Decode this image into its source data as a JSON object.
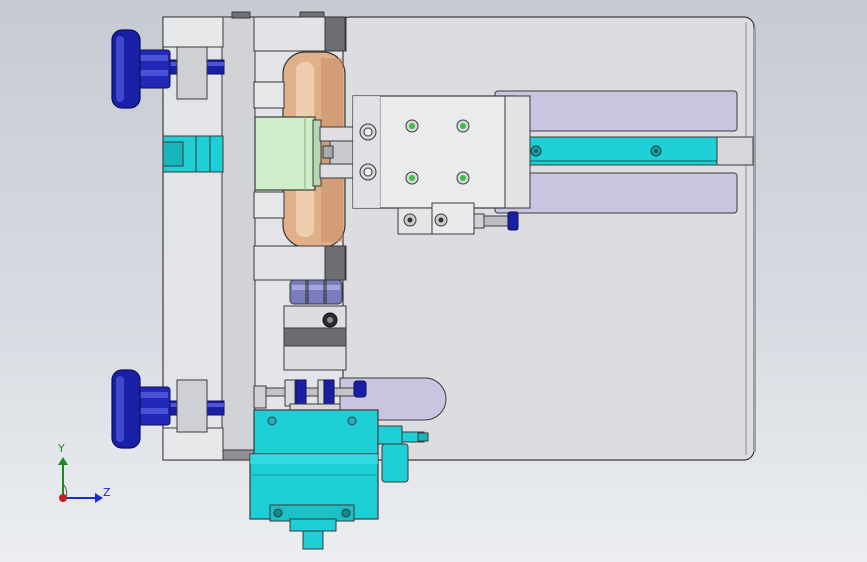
{
  "viewport": {
    "background_top": "#c6cbd3",
    "background_bottom": "#eceef1"
  },
  "colors": {
    "plate": "#dcdde0",
    "plate_shadow": "#b3b5ba",
    "edge": "#3a3a3a",
    "knob_blue": "#1a1fa8",
    "cyan": "#1fcfd6",
    "copper": "#e0b089",
    "green_block": "#cdeec9",
    "lavender": "#c9c5e0",
    "screw_green": "#39c43b"
  },
  "triad": {
    "y_label": "Y",
    "z_label": "Z",
    "y_color": "#1c8a1c",
    "z_color": "#1d2bd6",
    "x_color": "#d11a1a"
  },
  "icons": {
    "triad": "view-orientation-triad-icon"
  }
}
